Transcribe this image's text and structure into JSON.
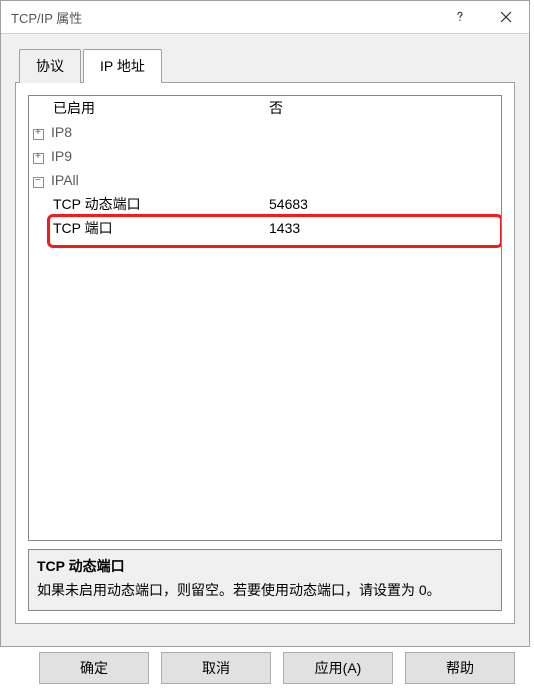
{
  "window": {
    "title": "TCP/IP 属性"
  },
  "tabs": {
    "protocol": "协议",
    "ipaddr": "IP 地址"
  },
  "rows": {
    "enabled_label": "已启用",
    "enabled_value": "否",
    "ip8": "IP8",
    "ip9": "IP9",
    "ipall": "IPAll",
    "tcp_dyn_label": "TCP 动态端口",
    "tcp_dyn_value": "54683",
    "tcp_port_label": "TCP 端口",
    "tcp_port_value": "1433"
  },
  "description": {
    "title": "TCP 动态端口",
    "text": "如果未启用动态端口，则留空。若要使用动态端口，请设置为 0。"
  },
  "buttons": {
    "ok": "确定",
    "cancel": "取消",
    "apply": "应用(A)",
    "help": "帮助"
  },
  "icons": {
    "plus": "+",
    "minus": "−"
  }
}
